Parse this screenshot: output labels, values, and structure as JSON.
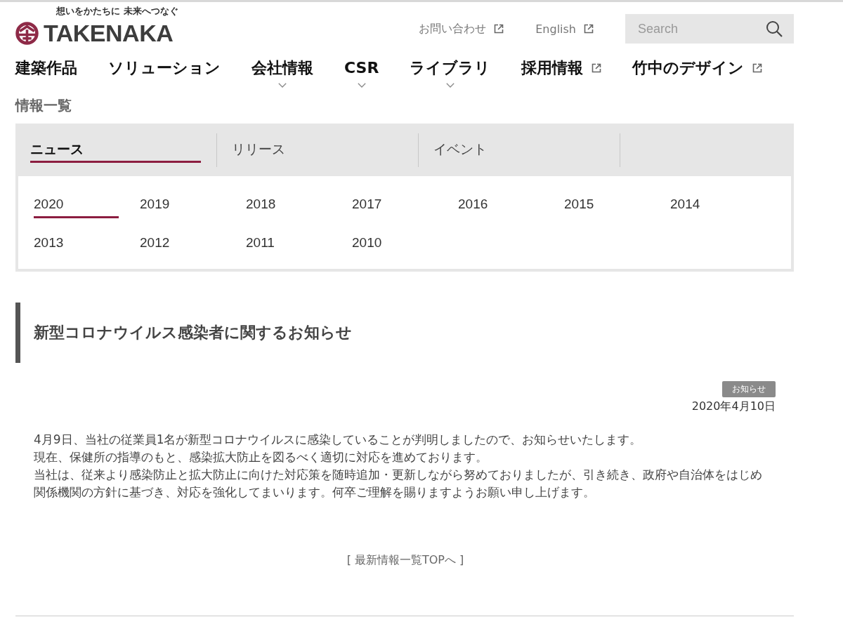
{
  "header": {
    "tagline": "想いをかたちに 未来へつなぐ",
    "logo_text": "TAKENAKA",
    "utility_links": [
      {
        "label": "お問い合わせ",
        "external": true
      },
      {
        "label": "English",
        "external": true
      }
    ],
    "search": {
      "placeholder": "Search"
    }
  },
  "nav": [
    {
      "label": "建築作品",
      "dropdown": false,
      "external": false
    },
    {
      "label": "ソリューション",
      "dropdown": false,
      "external": false
    },
    {
      "label": "会社情報",
      "dropdown": true,
      "external": false
    },
    {
      "label": "CSR",
      "dropdown": true,
      "external": false
    },
    {
      "label": "ライブラリ",
      "dropdown": true,
      "external": false
    },
    {
      "label": "採用情報",
      "dropdown": false,
      "external": true
    },
    {
      "label": "竹中のデザイン",
      "dropdown": false,
      "external": true
    }
  ],
  "page_title": "情報一覧",
  "category_tabs": [
    {
      "label": "ニュース",
      "selected": true
    },
    {
      "label": "リリース",
      "selected": false
    },
    {
      "label": "イベント",
      "selected": false
    }
  ],
  "years": [
    {
      "label": "2020",
      "selected": true
    },
    {
      "label": "2019",
      "selected": false
    },
    {
      "label": "2018",
      "selected": false
    },
    {
      "label": "2017",
      "selected": false
    },
    {
      "label": "2016",
      "selected": false
    },
    {
      "label": "2015",
      "selected": false
    },
    {
      "label": "2014",
      "selected": false
    },
    {
      "label": "2013",
      "selected": false
    },
    {
      "label": "2012",
      "selected": false
    },
    {
      "label": "2011",
      "selected": false
    },
    {
      "label": "2010",
      "selected": false
    }
  ],
  "article": {
    "title": "新型コロナウイルス感染者に関するお知らせ",
    "tag": "お知らせ",
    "date": "2020年4月10日",
    "paragraphs": [
      "4月9日、当社の従業員1名が新型コロナウイルスに感染していることが判明しましたので、お知らせいたします。",
      "現在、保健所の指導のもと、感染拡大防止を図るべく適切に対応を進めております。",
      "当社は、従来より感染防止と拡大防止に向けた対応策を随時追加・更新しながら努めておりましたが、引き続き、政府や自治体をはじめ関係機関の方針に基づき、対応を強化してまいります。何卒ご理解を賜りますようお願い申し上げます。"
    ]
  },
  "back_link": "[ 最新情報一覧TOPへ ]"
}
